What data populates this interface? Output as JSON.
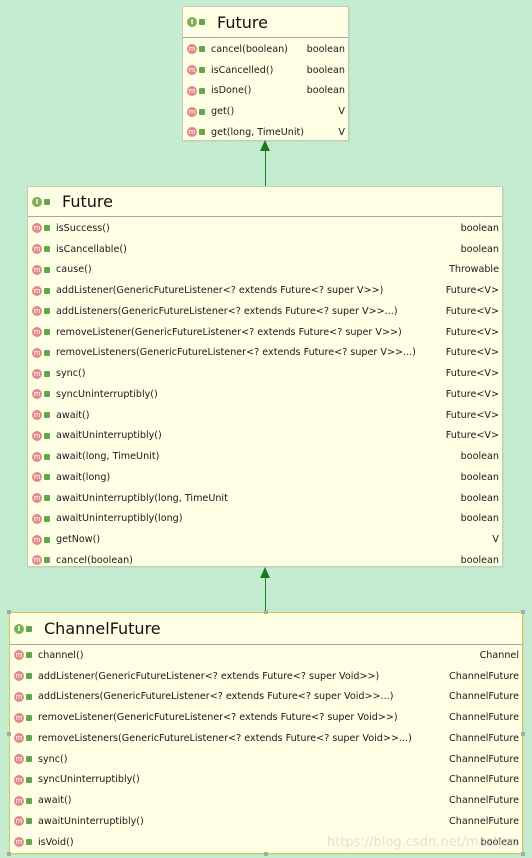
{
  "future_top": {
    "title": "Future",
    "rows": [
      {
        "name": "cancel(boolean)",
        "type": "boolean"
      },
      {
        "name": "isCancelled()",
        "type": "boolean"
      },
      {
        "name": "isDone()",
        "type": "boolean"
      },
      {
        "name": "get()",
        "type": "V"
      },
      {
        "name": "get(long, TimeUnit)",
        "type": "V"
      }
    ]
  },
  "future_mid": {
    "title": "Future",
    "rows": [
      {
        "name": "isSuccess()",
        "type": "boolean"
      },
      {
        "name": "isCancellable()",
        "type": "boolean"
      },
      {
        "name": "cause()",
        "type": "Throwable"
      },
      {
        "name": "addListener(GenericFutureListener<? extends Future<? super V>>)",
        "type": "Future<V>"
      },
      {
        "name": "addListeners(GenericFutureListener<? extends Future<? super V>>...)",
        "type": "Future<V>"
      },
      {
        "name": "removeListener(GenericFutureListener<? extends Future<? super V>>)",
        "type": "Future<V>"
      },
      {
        "name": "removeListeners(GenericFutureListener<? extends Future<? super V>>...)",
        "type": "Future<V>"
      },
      {
        "name": "sync()",
        "type": "Future<V>"
      },
      {
        "name": "syncUninterruptibly()",
        "type": "Future<V>"
      },
      {
        "name": "await()",
        "type": "Future<V>"
      },
      {
        "name": "awaitUninterruptibly()",
        "type": "Future<V>"
      },
      {
        "name": "await(long, TimeUnit)",
        "type": "boolean"
      },
      {
        "name": "await(long)",
        "type": "boolean"
      },
      {
        "name": "awaitUninterruptibly(long, TimeUnit",
        "type": "boolean"
      },
      {
        "name": "awaitUninterruptibly(long)",
        "type": "boolean"
      },
      {
        "name": "getNow()",
        "type": "V"
      },
      {
        "name": "cancel(boolean)",
        "type": "boolean"
      }
    ]
  },
  "channel_future": {
    "title": "ChannelFuture",
    "rows": [
      {
        "name": "channel()",
        "type": "Channel"
      },
      {
        "name": "addListener(GenericFutureListener<? extends Future<? super Void>>)",
        "type": "ChannelFuture"
      },
      {
        "name": "addListeners(GenericFutureListener<? extends Future<? super Void>>...)",
        "type": "ChannelFuture"
      },
      {
        "name": "removeListener(GenericFutureListener<? extends Future<? super Void>>)",
        "type": "ChannelFuture"
      },
      {
        "name": "removeListeners(GenericFutureListener<? extends Future<? super Void>>...)",
        "type": "ChannelFuture"
      },
      {
        "name": "sync()",
        "type": "ChannelFuture"
      },
      {
        "name": "syncUninterruptibly()",
        "type": "ChannelFuture"
      },
      {
        "name": "await()",
        "type": "ChannelFuture"
      },
      {
        "name": "awaitUninterruptibly()",
        "type": "ChannelFuture"
      },
      {
        "name": "isVoid()",
        "type": "boolean"
      }
    ]
  },
  "watermark": "https://blog.csdn.net/mazhen"
}
